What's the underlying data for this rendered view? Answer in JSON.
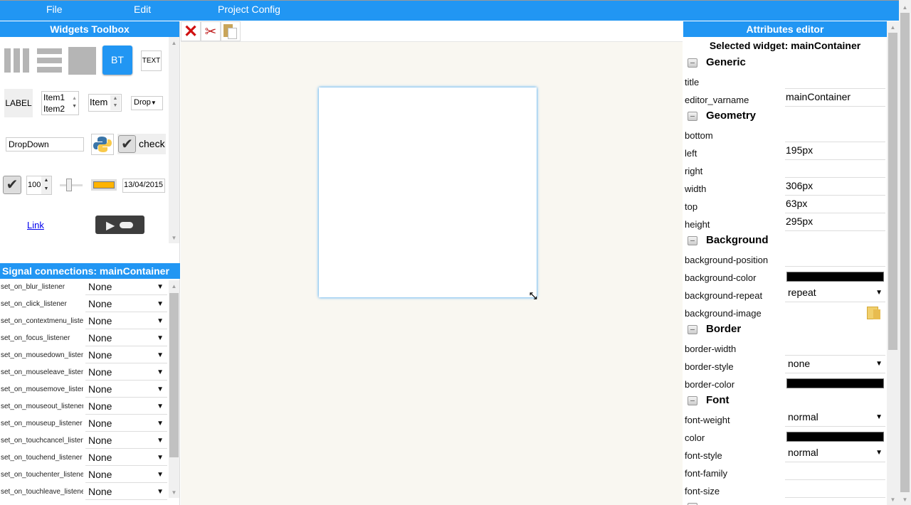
{
  "menu": {
    "file": "File",
    "edit": "Edit",
    "project_config": "Project Config"
  },
  "toolbox": {
    "title": "Widgets Toolbox",
    "button": "BT",
    "text": "TEXT",
    "label": "LABEL",
    "list_items": [
      "Item1",
      "Item2"
    ],
    "spin_item": "Item",
    "drop": "Drop",
    "dropdown_input": "DropDown",
    "check": "check",
    "spin_value": "100",
    "date": "13/04/2015",
    "link": "Link",
    "colors": {
      "accent": "#2196f3",
      "progress": "#ffb300"
    }
  },
  "signals": {
    "title": "Signal connections: mainContainer",
    "rows": [
      {
        "label": "set_on_blur_listener",
        "value": "None"
      },
      {
        "label": "set_on_click_listener",
        "value": "None"
      },
      {
        "label": "set_on_contextmenu_listener",
        "value": "None"
      },
      {
        "label": "set_on_focus_listener",
        "value": "None"
      },
      {
        "label": "set_on_mousedown_listener",
        "value": "None"
      },
      {
        "label": "set_on_mouseleave_listener",
        "value": "None"
      },
      {
        "label": "set_on_mousemove_listener",
        "value": "None"
      },
      {
        "label": "set_on_mouseout_listener",
        "value": "None"
      },
      {
        "label": "set_on_mouseup_listener",
        "value": "None"
      },
      {
        "label": "set_on_touchcancel_listener",
        "value": "None"
      },
      {
        "label": "set_on_touchend_listener",
        "value": "None"
      },
      {
        "label": "set_on_touchenter_listener",
        "value": "None"
      },
      {
        "label": "set_on_touchleave_listener",
        "value": "None"
      }
    ]
  },
  "toolbar": {
    "icons": [
      "delete-icon",
      "cut-icon",
      "paste-icon"
    ]
  },
  "attributes": {
    "title": "Attributes editor",
    "selected": "Selected widget: mainContainer",
    "generic": {
      "title": "Generic",
      "title_label": "title",
      "title_value": "",
      "varname_label": "editor_varname",
      "varname_value": "mainContainer"
    },
    "geometry": {
      "title": "Geometry",
      "bottom": "bottom",
      "left": "left",
      "left_value": "195px",
      "right": "right",
      "width": "width",
      "width_value": "306px",
      "top": "top",
      "top_value": "63px",
      "height": "height",
      "height_value": "295px"
    },
    "background": {
      "title": "Background",
      "position": "background-position",
      "color": "background-color",
      "color_value": "#000000",
      "repeat": "background-repeat",
      "repeat_value": "repeat",
      "image": "background-image"
    },
    "border": {
      "title": "Border",
      "width": "border-width",
      "style": "border-style",
      "style_value": "none",
      "color": "border-color",
      "color_value": "#000000"
    },
    "font": {
      "title": "Font",
      "weight": "font-weight",
      "weight_value": "normal",
      "color": "color",
      "color_value": "#000000",
      "style": "font-style",
      "style_value": "normal",
      "family": "font-family",
      "size": "font-size"
    }
  }
}
